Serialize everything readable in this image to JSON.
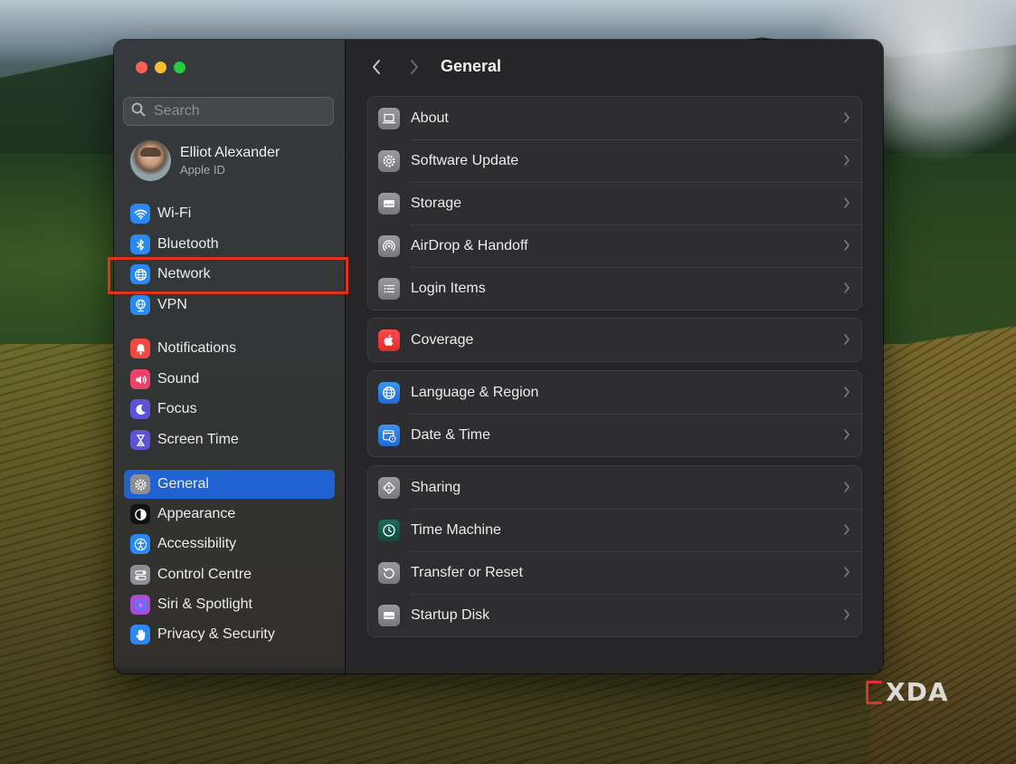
{
  "window": {
    "title": "General"
  },
  "search": {
    "placeholder": "Search"
  },
  "profile": {
    "name": "Elliot Alexander",
    "subtitle": "Apple ID"
  },
  "sidebar": {
    "items": [
      {
        "label": "Wi-Fi",
        "icon": "wifi-icon",
        "color": "#2b88f0"
      },
      {
        "label": "Bluetooth",
        "icon": "bluetooth-icon",
        "color": "#2b88f0"
      },
      {
        "label": "Network",
        "icon": "globe-icon",
        "color": "#2b88f0",
        "highlighted": true
      },
      {
        "label": "VPN",
        "icon": "vpn-globe-icon",
        "color": "#2b88f0"
      },
      {
        "label": "Notifications",
        "icon": "bell-icon",
        "color": "#f0493f"
      },
      {
        "label": "Sound",
        "icon": "speaker-icon",
        "color": "#f0416b"
      },
      {
        "label": "Focus",
        "icon": "moon-icon",
        "color": "#5d53d6"
      },
      {
        "label": "Screen Time",
        "icon": "hourglass-icon",
        "color": "#5d53d6"
      },
      {
        "label": "General",
        "icon": "gear-icon",
        "color": "#8e8e93",
        "selected": true
      },
      {
        "label": "Appearance",
        "icon": "appearance-icon",
        "color": "#111111"
      },
      {
        "label": "Accessibility",
        "icon": "accessibility-icon",
        "color": "#2b88f0"
      },
      {
        "label": "Control Centre",
        "icon": "control-centre-icon",
        "color": "#8e8e93"
      },
      {
        "label": "Siri & Spotlight",
        "icon": "siri-icon",
        "color": "#a44fd6"
      },
      {
        "label": "Privacy & Security",
        "icon": "hand-icon",
        "color": "#2b88f0"
      }
    ]
  },
  "main": {
    "groups": [
      [
        {
          "label": "About",
          "icon": "laptop-icon"
        },
        {
          "label": "Software Update",
          "icon": "gear-update-icon"
        },
        {
          "label": "Storage",
          "icon": "storage-icon"
        },
        {
          "label": "AirDrop & Handoff",
          "icon": "airdrop-icon"
        },
        {
          "label": "Login Items",
          "icon": "list-icon"
        }
      ],
      [
        {
          "label": "Coverage",
          "icon": "apple-icon"
        }
      ],
      [
        {
          "label": "Language & Region",
          "icon": "globe-icon"
        },
        {
          "label": "Date & Time",
          "icon": "calendar-clock-icon"
        }
      ],
      [
        {
          "label": "Sharing",
          "icon": "sharing-icon"
        },
        {
          "label": "Time Machine",
          "icon": "time-machine-icon"
        },
        {
          "label": "Transfer or Reset",
          "icon": "reset-icon"
        },
        {
          "label": "Startup Disk",
          "icon": "disk-icon"
        }
      ]
    ]
  },
  "watermark": {
    "text": "XDA"
  }
}
